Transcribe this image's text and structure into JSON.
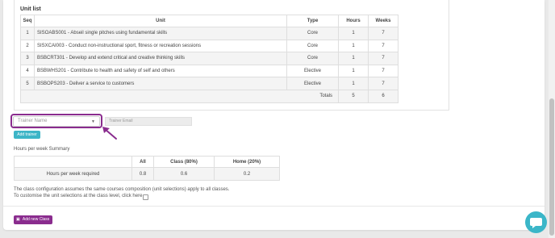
{
  "unit_list": {
    "title": "Unit list",
    "columns": [
      "Seq",
      "Unit",
      "Type",
      "Hours",
      "Weeks"
    ],
    "rows": [
      {
        "seq": "1",
        "unit": "SISOABS001 - Abseil single pitches using fundamental skills",
        "type": "Core",
        "hours": "1",
        "weeks": "7"
      },
      {
        "seq": "2",
        "unit": "SISXCAI003 - Conduct non-instructional sport, fitness or recreation sessions",
        "type": "Core",
        "hours": "1",
        "weeks": "7"
      },
      {
        "seq": "3",
        "unit": "BSBCRT301 - Develop and extend critical and creative thinking skills",
        "type": "Core",
        "hours": "1",
        "weeks": "7"
      },
      {
        "seq": "4",
        "unit": "BSBWHS201 - Contribute to health and safety of self and others",
        "type": "Elective",
        "hours": "1",
        "weeks": "7"
      },
      {
        "seq": "5",
        "unit": "BSBOPS203 - Deliver a service to customers",
        "type": "Elective",
        "hours": "1",
        "weeks": "7"
      }
    ],
    "totals": {
      "label": "Totals",
      "hours": "5",
      "weeks": "6"
    }
  },
  "trainer": {
    "name_placeholder": "Trainer Name",
    "email_placeholder": "Trainer Email",
    "add_button": "Add trainer"
  },
  "hours_summary": {
    "title": "Hours per week Summary",
    "columns": [
      "",
      "All",
      "Class (80%)",
      "Home (20%)"
    ],
    "row": {
      "label": "Hours per week required",
      "all": "0.8",
      "class": "0.6",
      "home": "0.2"
    }
  },
  "notes": {
    "line1": "The class configuration assumes the same courses composition (unit selections) apply to all classes.",
    "line2": "To customise the unit selections at the class level, click here"
  },
  "actions": {
    "add_class": "Add new Class"
  },
  "colors": {
    "accent_purple": "#8a2c8e",
    "accent_teal": "#3db5c7"
  },
  "icons": {
    "select_caret": "caret-down-icon",
    "add_class": "calendar-plus-icon",
    "chat": "chat-bubble-icon",
    "annotation_arrow": "arrow-icon"
  }
}
